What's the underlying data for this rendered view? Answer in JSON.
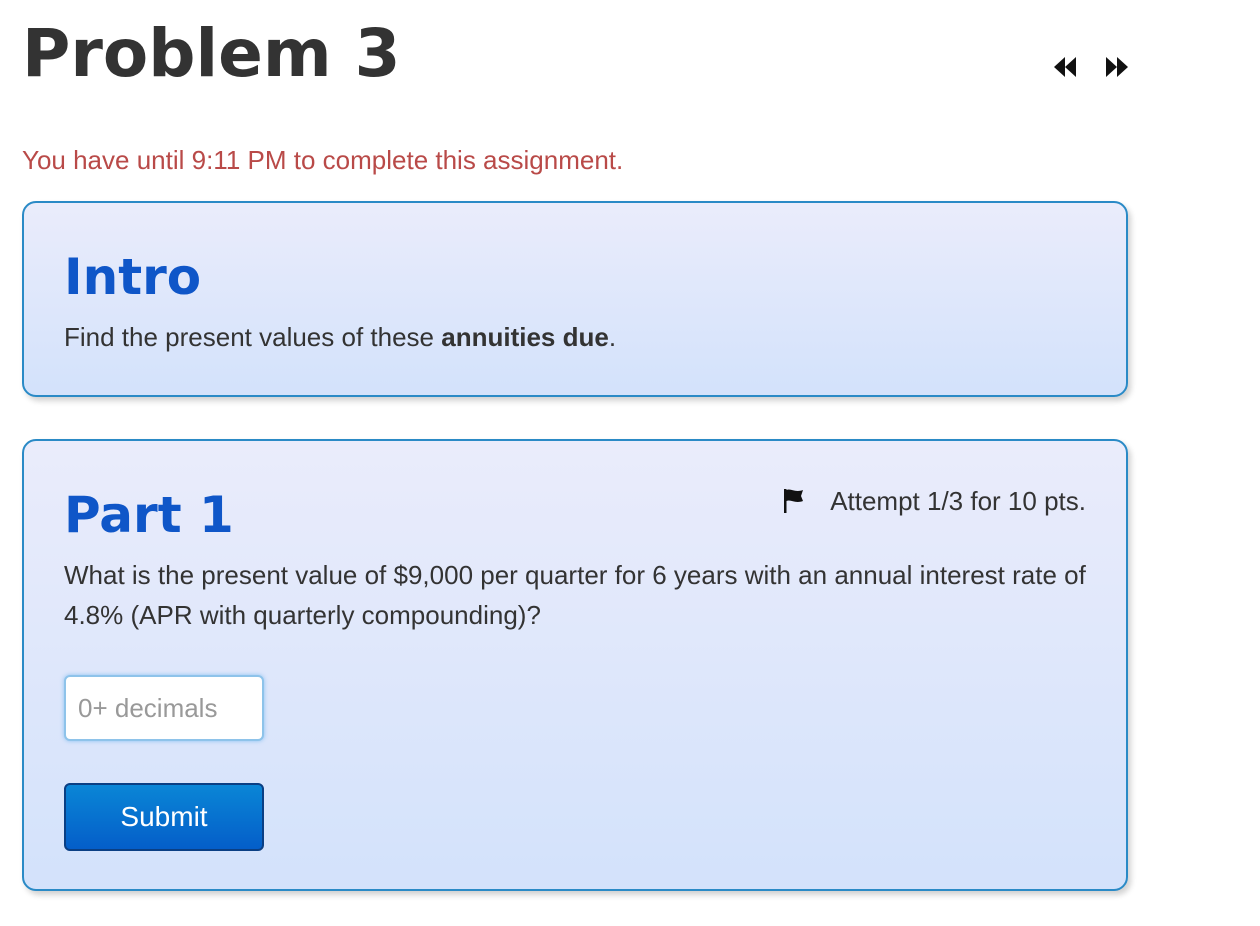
{
  "problem": {
    "title": "Problem 3"
  },
  "nav": {
    "prev_icon": "double-chevron-left",
    "next_icon": "double-chevron-right"
  },
  "deadline": {
    "text": "You have until 9:11 PM to complete this assignment."
  },
  "intro": {
    "heading": "Intro",
    "text_before": "Find the present values of these ",
    "text_bold": "annuities due",
    "text_after": "."
  },
  "part1": {
    "heading": "Part 1",
    "attempt_text": "Attempt 1/3 for 10 pts.",
    "flag_icon": "flag",
    "question": "What is the present value of $9,000 per quarter for 6 years with an annual interest rate of 4.8% (APR with quarterly compounding)?",
    "input": {
      "value": "",
      "placeholder": "0+ decimals"
    },
    "submit_label": "Submit"
  },
  "colors": {
    "heading_blue": "#0f56c8",
    "deadline_red": "#b94a48",
    "card_border": "#2a8ac6",
    "submit_bg": "#045ec9"
  }
}
